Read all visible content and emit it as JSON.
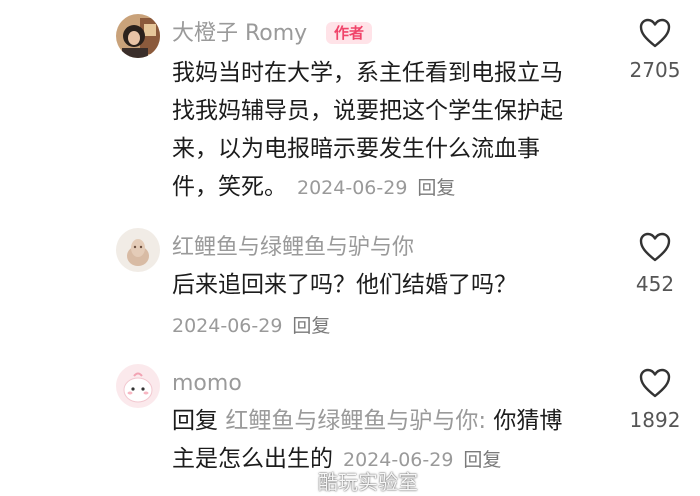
{
  "comments": [
    {
      "username": "大橙子 Romy",
      "badge": "作者",
      "lines": [
        "我妈当时在大学，系主任看到电报立马",
        "找我妈辅导员，说要把这个学生保护起",
        "来，以为电报暗示要发生什么流血事",
        "件，笑死。"
      ],
      "date": "2024-06-29",
      "reply_label": "回复",
      "likes": "2705"
    },
    {
      "username": "红鲤鱼与绿鲤鱼与驴与你",
      "lines": [
        "后来追回来了吗？他们结婚了吗？"
      ],
      "date": "2024-06-29",
      "reply_label": "回复",
      "likes": "452"
    },
    {
      "username": "momo",
      "reply_prefix": "回复",
      "mention": "红鲤鱼与绿鲤鱼与驴与你:",
      "line1_text": "你猜博",
      "line2_text": "主是怎么出生的",
      "date": "2024-06-29",
      "reply_label": "回复",
      "likes": "1892"
    }
  ],
  "like_icon": "heart-outline-icon",
  "watermark": "酷玩实验室",
  "colors": {
    "username": "#9a9a9a",
    "badge_bg": "#ffe3e8",
    "badge_text": "#f0446a",
    "text": "#1c1c1c"
  }
}
